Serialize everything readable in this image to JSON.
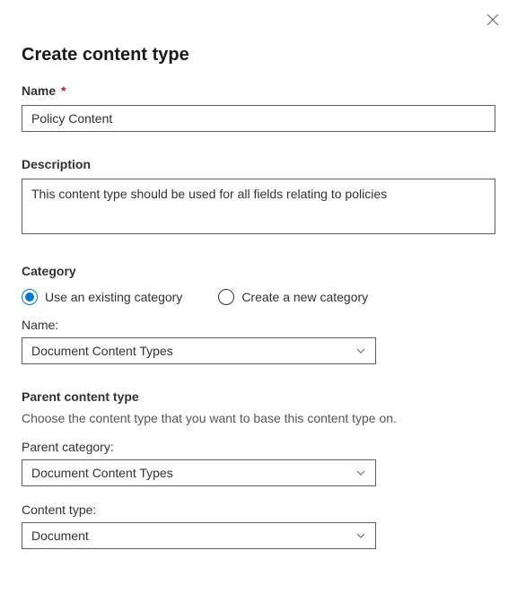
{
  "dialog": {
    "title": "Create content type"
  },
  "name_field": {
    "label": "Name",
    "required_marker": "*",
    "value": "Policy Content"
  },
  "description_field": {
    "label": "Description",
    "value": "This content type should be used for all fields relating to policies"
  },
  "category_section": {
    "label": "Category",
    "radio_options": {
      "existing": "Use an existing category",
      "new": "Create a new category"
    },
    "name_label": "Name:",
    "selected_value": "Document Content Types"
  },
  "parent_section": {
    "label": "Parent content type",
    "helper": "Choose the content type that you want to base this content type on.",
    "parent_category_label": "Parent category:",
    "parent_category_value": "Document Content Types",
    "content_type_label": "Content type:",
    "content_type_value": "Document"
  }
}
